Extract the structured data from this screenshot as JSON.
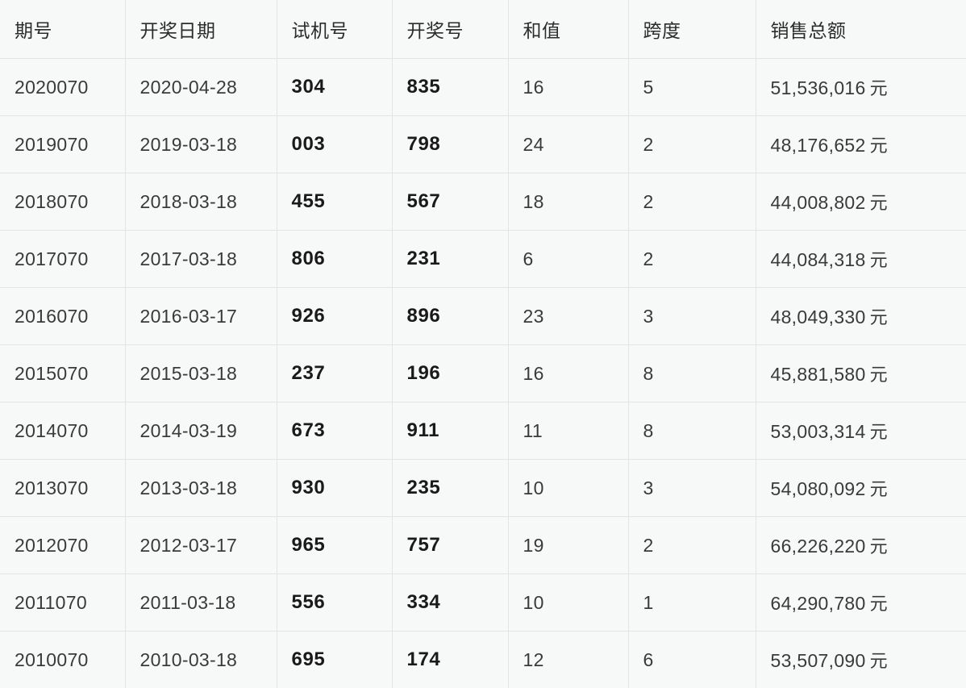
{
  "table": {
    "columns": [
      {
        "key": "issue",
        "label": "期号",
        "name": "column-issue"
      },
      {
        "key": "date",
        "label": "开奖日期",
        "name": "column-draw-date"
      },
      {
        "key": "test",
        "label": "试机号",
        "name": "column-test-number"
      },
      {
        "key": "draw",
        "label": "开奖号",
        "name": "column-draw-number"
      },
      {
        "key": "sum",
        "label": "和值",
        "name": "column-sum-value"
      },
      {
        "key": "span",
        "label": "跨度",
        "name": "column-span"
      },
      {
        "key": "sales",
        "label": "销售总额",
        "name": "column-total-sales"
      }
    ],
    "currency_suffix": "元",
    "rows": [
      {
        "issue": "2020070",
        "date": "2020-04-28",
        "test": "304",
        "draw": "835",
        "sum": "16",
        "span": "5",
        "sales": "51,536,016"
      },
      {
        "issue": "2019070",
        "date": "2019-03-18",
        "test": "003",
        "draw": "798",
        "sum": "24",
        "span": "2",
        "sales": "48,176,652"
      },
      {
        "issue": "2018070",
        "date": "2018-03-18",
        "test": "455",
        "draw": "567",
        "sum": "18",
        "span": "2",
        "sales": "44,008,802"
      },
      {
        "issue": "2017070",
        "date": "2017-03-18",
        "test": "806",
        "draw": "231",
        "sum": "6",
        "span": "2",
        "sales": "44,084,318"
      },
      {
        "issue": "2016070",
        "date": "2016-03-17",
        "test": "926",
        "draw": "896",
        "sum": "23",
        "span": "3",
        "sales": "48,049,330"
      },
      {
        "issue": "2015070",
        "date": "2015-03-18",
        "test": "237",
        "draw": "196",
        "sum": "16",
        "span": "8",
        "sales": "45,881,580"
      },
      {
        "issue": "2014070",
        "date": "2014-03-19",
        "test": "673",
        "draw": "911",
        "sum": "11",
        "span": "8",
        "sales": "53,003,314"
      },
      {
        "issue": "2013070",
        "date": "2013-03-18",
        "test": "930",
        "draw": "235",
        "sum": "10",
        "span": "3",
        "sales": "54,080,092"
      },
      {
        "issue": "2012070",
        "date": "2012-03-17",
        "test": "965",
        "draw": "757",
        "sum": "19",
        "span": "2",
        "sales": "66,226,220"
      },
      {
        "issue": "2011070",
        "date": "2011-03-18",
        "test": "556",
        "draw": "334",
        "sum": "10",
        "span": "1",
        "sales": "64,290,780"
      },
      {
        "issue": "2010070",
        "date": "2010-03-18",
        "test": "695",
        "draw": "174",
        "sum": "12",
        "span": "6",
        "sales": "53,507,090"
      }
    ]
  },
  "colors": {
    "background": "#f7f8f8",
    "grid_line": "#e2e4e6",
    "text": "#3a3a3a",
    "text_strong": "#1a1a1a"
  }
}
